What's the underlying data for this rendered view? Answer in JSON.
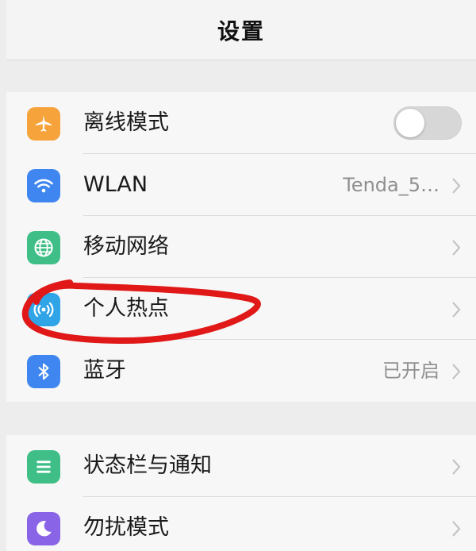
{
  "header": {
    "title": "设置"
  },
  "group1": {
    "items": [
      {
        "label": "离线模式",
        "icon": "airplane-icon",
        "icon_color": "#f6a33b",
        "control": "toggle",
        "toggle_on": false
      },
      {
        "label": "WLAN",
        "icon": "wifi-icon",
        "icon_color": "#3f86f0",
        "value": "Tenda_5…",
        "control": "chevron"
      },
      {
        "label": "移动网络",
        "icon": "globe-icon",
        "icon_color": "#3fbf87",
        "control": "chevron"
      },
      {
        "label": "个人热点",
        "icon": "hotspot-icon",
        "icon_color": "#2fa4e7",
        "control": "chevron"
      },
      {
        "label": "蓝牙",
        "icon": "bluetooth-icon",
        "icon_color": "#3f86f0",
        "value": "已开启",
        "control": "chevron"
      }
    ]
  },
  "group2": {
    "items": [
      {
        "label": "状态栏与通知",
        "icon": "notification-list-icon",
        "icon_color": "#3fbf87",
        "control": "chevron"
      },
      {
        "label": "勿扰模式",
        "icon": "moon-icon",
        "icon_color": "#8a64e6",
        "control": "chevron"
      }
    ]
  },
  "annotation": {
    "color": "#e01818"
  }
}
